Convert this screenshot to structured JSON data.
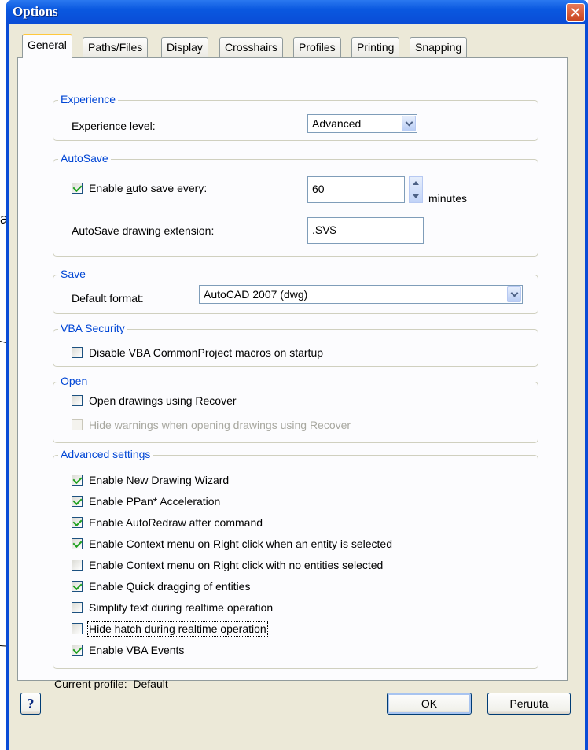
{
  "window": {
    "title": "Options"
  },
  "external": {
    "partial_text": "a"
  },
  "tabs": [
    {
      "label": "General",
      "active": true
    },
    {
      "label": "Paths/Files",
      "active": false
    },
    {
      "label": "Display",
      "active": false
    },
    {
      "label": "Crosshairs",
      "active": false
    },
    {
      "label": "Profiles",
      "active": false
    },
    {
      "label": "Printing",
      "active": false
    },
    {
      "label": "Snapping",
      "active": false
    }
  ],
  "experience": {
    "legend": "Experience",
    "label_pre": "",
    "label_mnemonic": "E",
    "label_post": "xperience level:",
    "value": "Advanced"
  },
  "autosave": {
    "legend": "AutoSave",
    "enable_pre": "Enable ",
    "enable_mnemonic": "a",
    "enable_post": "uto save every:",
    "enable_checked": true,
    "minutes_value": "60",
    "minutes_unit": "minutes",
    "extension_label": "AutoSave drawing extension:",
    "extension_value": ".SV$"
  },
  "save": {
    "legend": "Save",
    "format_label": "Default format:",
    "format_value": "AutoCAD 2007 (dwg)"
  },
  "vba": {
    "legend": "VBA Security",
    "disable_label": "Disable VBA CommonProject macros on startup",
    "disable_checked": false
  },
  "open": {
    "legend": "Open",
    "recover_label": "Open drawings using Recover",
    "recover_checked": false,
    "hide_warnings_label": "Hide warnings when opening drawings using Recover",
    "hide_warnings_checked": false,
    "hide_warnings_enabled": false
  },
  "advanced": {
    "legend": "Advanced settings",
    "items": [
      {
        "label": "Enable New Drawing Wizard",
        "checked": true
      },
      {
        "label": "Enable PPan* Acceleration",
        "checked": true
      },
      {
        "label": "Enable AutoRedraw after command",
        "checked": true
      },
      {
        "label": "Enable Context menu on Right click when an entity is selected",
        "checked": true
      },
      {
        "label": "Enable Context menu on Right click with no entities selected",
        "checked": false
      },
      {
        "label": "Enable Quick dragging of entities",
        "checked": true
      },
      {
        "label": "Simplify text during realtime operation",
        "checked": false
      },
      {
        "label": "Hide hatch during realtime operation",
        "checked": false,
        "focused": true
      },
      {
        "label": "Enable VBA Events",
        "checked": true
      }
    ]
  },
  "current_profile": {
    "label": "Current profile:",
    "value": "Default"
  },
  "buttons": {
    "help": "?",
    "ok": "OK",
    "cancel": "Peruuta"
  }
}
